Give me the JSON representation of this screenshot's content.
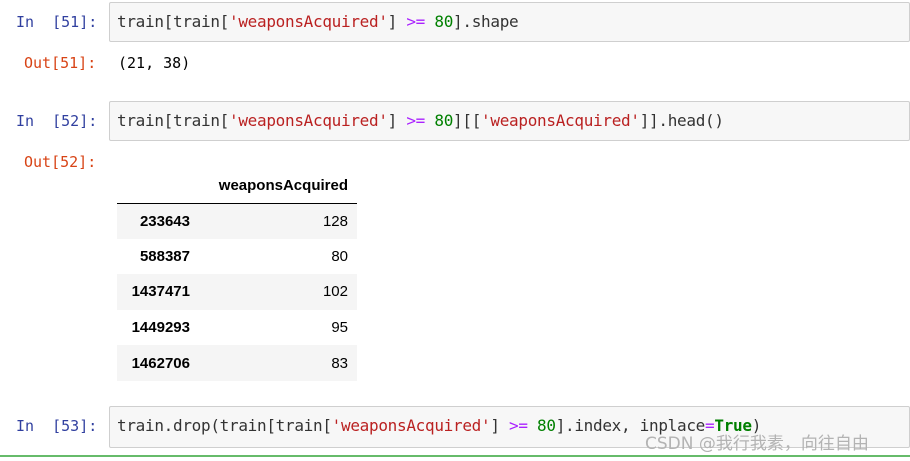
{
  "cells": [
    {
      "in_prompt": "In  [51]:",
      "out_prompt": "Out[51]:",
      "code_tokens": [
        {
          "t": "train[train[",
          "c": ""
        },
        {
          "t": "'weaponsAcquired'",
          "c": "tk-str"
        },
        {
          "t": "] ",
          "c": ""
        },
        {
          "t": ">=",
          "c": "tk-op"
        },
        {
          "t": " ",
          "c": ""
        },
        {
          "t": "80",
          "c": "tk-num"
        },
        {
          "t": "].shape",
          "c": ""
        }
      ],
      "output_text": "(21, 38)"
    },
    {
      "in_prompt": "In  [52]:",
      "out_prompt": "Out[52]:",
      "code_tokens": [
        {
          "t": "train[train[",
          "c": ""
        },
        {
          "t": "'weaponsAcquired'",
          "c": "tk-str"
        },
        {
          "t": "] ",
          "c": ""
        },
        {
          "t": ">=",
          "c": "tk-op"
        },
        {
          "t": " ",
          "c": ""
        },
        {
          "t": "80",
          "c": "tk-num"
        },
        {
          "t": "][[",
          "c": ""
        },
        {
          "t": "'weaponsAcquired'",
          "c": "tk-str"
        },
        {
          "t": "]].head()",
          "c": ""
        }
      ],
      "table": {
        "column_header": "weaponsAcquired",
        "rows": [
          {
            "index": "233643",
            "value": "128"
          },
          {
            "index": "588387",
            "value": "80"
          },
          {
            "index": "1437471",
            "value": "102"
          },
          {
            "index": "1449293",
            "value": "95"
          },
          {
            "index": "1462706",
            "value": "83"
          }
        ]
      }
    },
    {
      "in_prompt": "In  [53]:",
      "code_tokens": [
        {
          "t": "train.drop(train[train[",
          "c": ""
        },
        {
          "t": "'weaponsAcquired'",
          "c": "tk-str"
        },
        {
          "t": "] ",
          "c": ""
        },
        {
          "t": ">=",
          "c": "tk-op"
        },
        {
          "t": " ",
          "c": ""
        },
        {
          "t": "80",
          "c": "tk-num"
        },
        {
          "t": "].index, inplace",
          "c": ""
        },
        {
          "t": "=",
          "c": "tk-op"
        },
        {
          "t": "True",
          "c": "tk-kw"
        },
        {
          "t": ")",
          "c": ""
        }
      ]
    }
  ],
  "watermark": "CSDN @我行我素，向往自由"
}
